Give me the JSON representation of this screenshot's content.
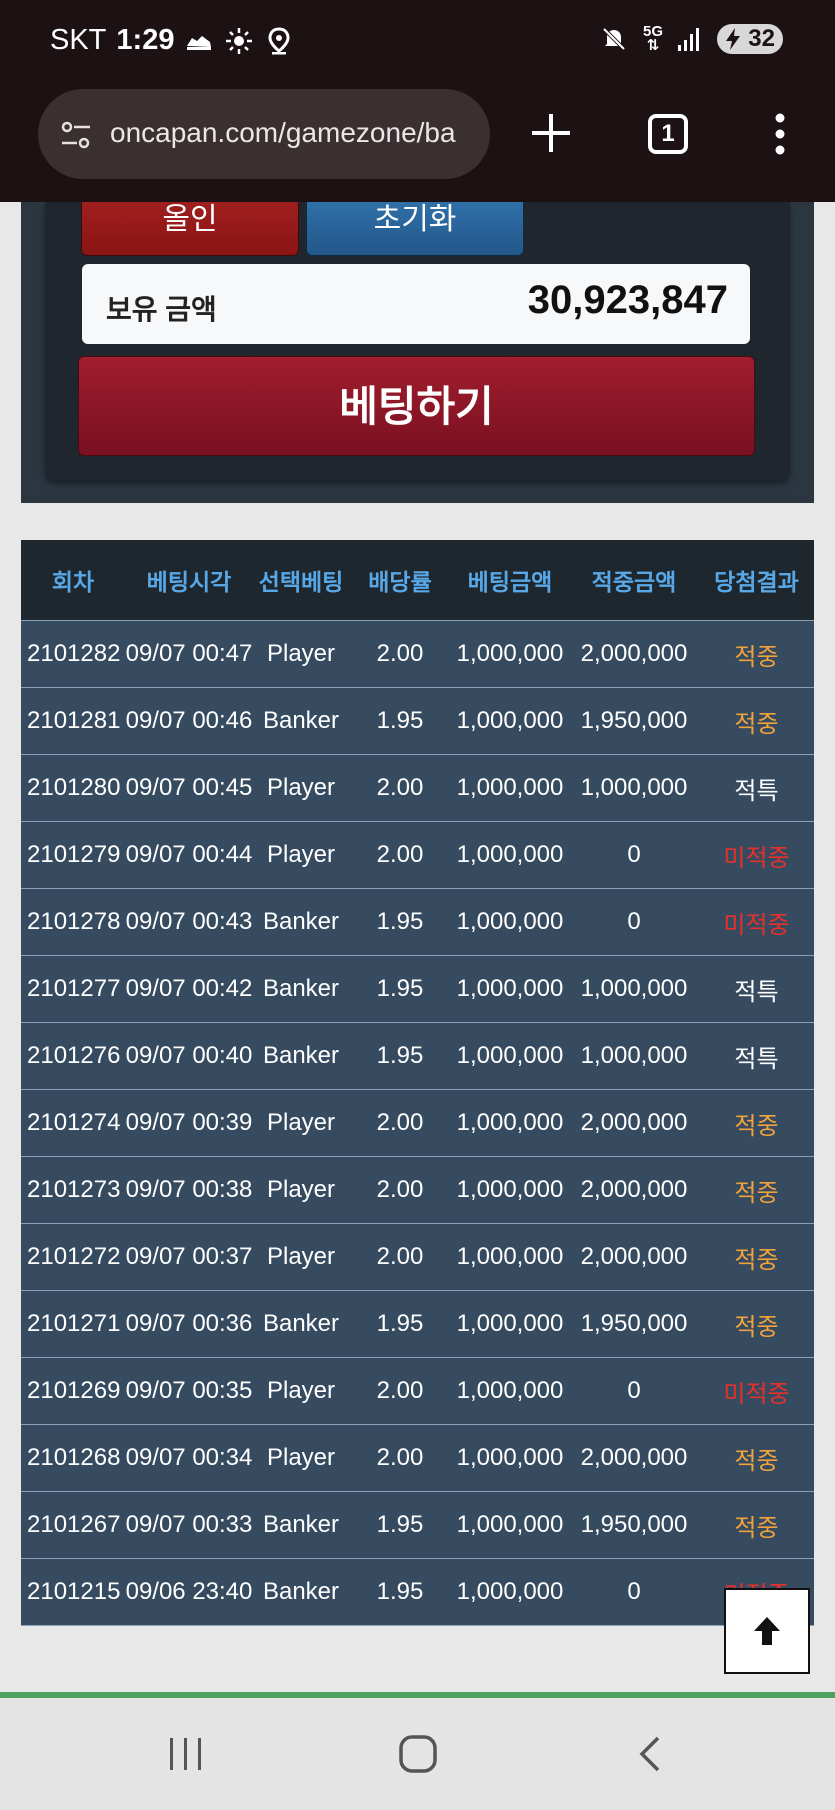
{
  "status_bar": {
    "carrier": "SKT",
    "time": "1:29",
    "network": "5G",
    "battery": "32",
    "icons": [
      "sneaker-icon",
      "sun-icon",
      "location-icon",
      "mute-icon",
      "network-5g-icon",
      "signal-icon",
      "battery-icon"
    ]
  },
  "browser": {
    "url": "oncapan.com/gamezone/ba",
    "tab_count": "1",
    "icons": [
      "site-settings-icon",
      "plus-icon",
      "tab-switcher-icon",
      "more-vert-icon"
    ]
  },
  "bet_panel": {
    "allin_label": "올인",
    "reset_label": "초기화",
    "balance_label": "보유 금액",
    "balance_value": "30,923,847",
    "bet_button_label": "베팅하기"
  },
  "history_table": {
    "headers": [
      "회차",
      "베팅시각",
      "선택베팅",
      "배당률",
      "베팅금액",
      "적중금액",
      "당첨결과"
    ],
    "rows": [
      {
        "round": "2101282",
        "time": "09/07 00:47",
        "pick": "Player",
        "odds": "2.00",
        "bet": "1,000,000",
        "win": "2,000,000",
        "result": "적중",
        "result_type": "hit"
      },
      {
        "round": "2101281",
        "time": "09/07 00:46",
        "pick": "Banker",
        "odds": "1.95",
        "bet": "1,000,000",
        "win": "1,950,000",
        "result": "적중",
        "result_type": "hit"
      },
      {
        "round": "2101280",
        "time": "09/07 00:45",
        "pick": "Player",
        "odds": "2.00",
        "bet": "1,000,000",
        "win": "1,000,000",
        "result": "적특",
        "result_type": "special"
      },
      {
        "round": "2101279",
        "time": "09/07 00:44",
        "pick": "Player",
        "odds": "2.00",
        "bet": "1,000,000",
        "win": "0",
        "result": "미적중",
        "result_type": "miss"
      },
      {
        "round": "2101278",
        "time": "09/07 00:43",
        "pick": "Banker",
        "odds": "1.95",
        "bet": "1,000,000",
        "win": "0",
        "result": "미적중",
        "result_type": "miss"
      },
      {
        "round": "2101277",
        "time": "09/07 00:42",
        "pick": "Banker",
        "odds": "1.95",
        "bet": "1,000,000",
        "win": "1,000,000",
        "result": "적특",
        "result_type": "special"
      },
      {
        "round": "2101276",
        "time": "09/07 00:40",
        "pick": "Banker",
        "odds": "1.95",
        "bet": "1,000,000",
        "win": "1,000,000",
        "result": "적특",
        "result_type": "special"
      },
      {
        "round": "2101274",
        "time": "09/07 00:39",
        "pick": "Player",
        "odds": "2.00",
        "bet": "1,000,000",
        "win": "2,000,000",
        "result": "적중",
        "result_type": "hit"
      },
      {
        "round": "2101273",
        "time": "09/07 00:38",
        "pick": "Player",
        "odds": "2.00",
        "bet": "1,000,000",
        "win": "2,000,000",
        "result": "적중",
        "result_type": "hit"
      },
      {
        "round": "2101272",
        "time": "09/07 00:37",
        "pick": "Player",
        "odds": "2.00",
        "bet": "1,000,000",
        "win": "2,000,000",
        "result": "적중",
        "result_type": "hit"
      },
      {
        "round": "2101271",
        "time": "09/07 00:36",
        "pick": "Banker",
        "odds": "1.95",
        "bet": "1,000,000",
        "win": "1,950,000",
        "result": "적중",
        "result_type": "hit"
      },
      {
        "round": "2101269",
        "time": "09/07 00:35",
        "pick": "Player",
        "odds": "2.00",
        "bet": "1,000,000",
        "win": "0",
        "result": "미적중",
        "result_type": "miss"
      },
      {
        "round": "2101268",
        "time": "09/07 00:34",
        "pick": "Player",
        "odds": "2.00",
        "bet": "1,000,000",
        "win": "2,000,000",
        "result": "적중",
        "result_type": "hit"
      },
      {
        "round": "2101267",
        "time": "09/07 00:33",
        "pick": "Banker",
        "odds": "1.95",
        "bet": "1,000,000",
        "win": "1,950,000",
        "result": "적중",
        "result_type": "hit"
      },
      {
        "round": "2101215",
        "time": "09/06 23:40",
        "pick": "Banker",
        "odds": "1.95",
        "bet": "1,000,000",
        "win": "0",
        "result": "미적중",
        "result_type": "miss"
      }
    ]
  },
  "scroll_top": {
    "icon": "arrow-up-icon"
  },
  "nav_bar": {
    "icons": [
      "recent-apps-icon",
      "home-icon",
      "back-icon"
    ]
  },
  "colors": {
    "hit": "#f0a23c",
    "miss": "#e8302a",
    "header_text": "#58a8e8",
    "row_bg": "#364b60",
    "bet_button": "#8a1424"
  }
}
